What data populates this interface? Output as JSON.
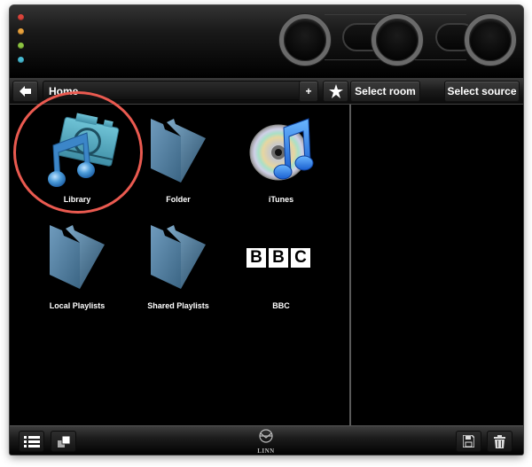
{
  "window": {
    "traffic_lights": [
      {
        "name": "close",
        "color": "#d9443b"
      },
      {
        "name": "minimize",
        "color": "#e8a13c"
      },
      {
        "name": "zoom",
        "color": "#8dc441"
      },
      {
        "name": "extra",
        "color": "#46b8d0"
      }
    ]
  },
  "toolbar": {
    "back_icon": "left-arrow-icon",
    "breadcrumb": "Home",
    "add_label": "+",
    "bookmark_icon": "star-icon",
    "select_room_label": "Select room",
    "select_source_label": "Select source"
  },
  "browser": {
    "items": [
      {
        "label": "Library",
        "icon": "library-icon"
      },
      {
        "label": "Folder",
        "icon": "folder-icon"
      },
      {
        "label": "iTunes",
        "icon": "itunes-icon"
      },
      {
        "label": "Local Playlists",
        "icon": "folder-icon"
      },
      {
        "label": "Shared Playlists",
        "icon": "folder-icon"
      },
      {
        "label": "BBC",
        "icon": "bbc-logo-icon"
      }
    ],
    "bbc_logo_letters": [
      "B",
      "B",
      "C"
    ]
  },
  "footer": {
    "list_view_icon": "list-icon",
    "album_view_icon": "stacked-squares-icon",
    "brand_text": "LINN",
    "save_icon": "save-icon",
    "delete_icon": "trash-icon"
  },
  "colors": {
    "annotation_circle": "#ea5a50",
    "background": "#000000",
    "folder_blue": "#5b86a8"
  }
}
